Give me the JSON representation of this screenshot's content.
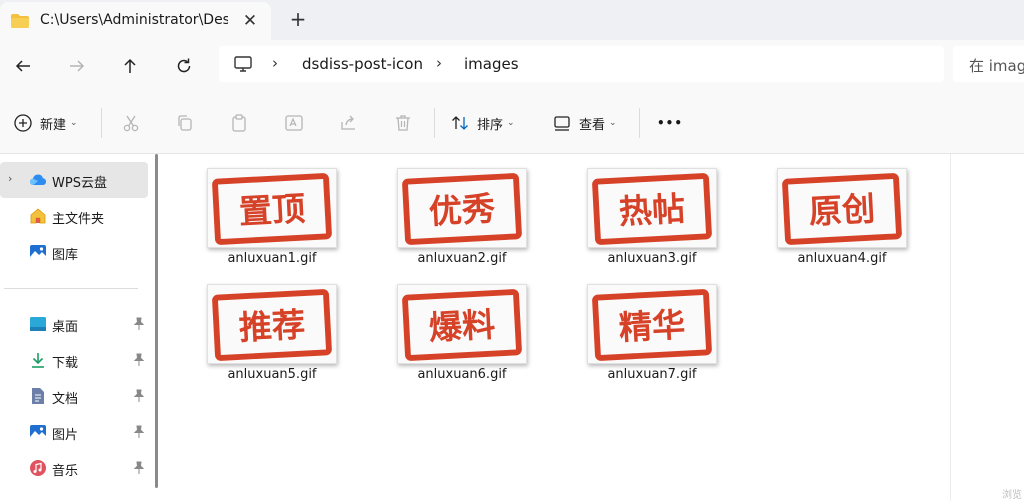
{
  "tab": {
    "title": "C:\\Users\\Administrator\\Desktop",
    "close": "✕",
    "new": "+"
  },
  "breadcrumb": {
    "items": [
      "dsdiss-post-icon",
      "images"
    ],
    "sep": "›"
  },
  "search": {
    "placeholder": "在 imag"
  },
  "commands": {
    "new": "新建",
    "sort": "排序",
    "view": "查看",
    "more": "•••"
  },
  "sidebar": {
    "wps": "WPS云盘",
    "home": "主文件夹",
    "gallery": "图库",
    "desktop": "桌面",
    "downloads": "下载",
    "documents": "文档",
    "pictures": "图片",
    "music": "音乐"
  },
  "files": [
    {
      "name": "anluxuan1.gif",
      "stamp": "置顶"
    },
    {
      "name": "anluxuan2.gif",
      "stamp": "优秀"
    },
    {
      "name": "anluxuan3.gif",
      "stamp": "热帖"
    },
    {
      "name": "anluxuan4.gif",
      "stamp": "原创"
    },
    {
      "name": "anluxuan5.gif",
      "stamp": "推荐"
    },
    {
      "name": "anluxuan6.gif",
      "stamp": "爆料"
    },
    {
      "name": "anluxuan7.gif",
      "stamp": "精华"
    }
  ],
  "corner": "浏览",
  "colors": {
    "stamp": "#d64228",
    "folder": "#f4c13d",
    "accent": "#0067c0"
  }
}
